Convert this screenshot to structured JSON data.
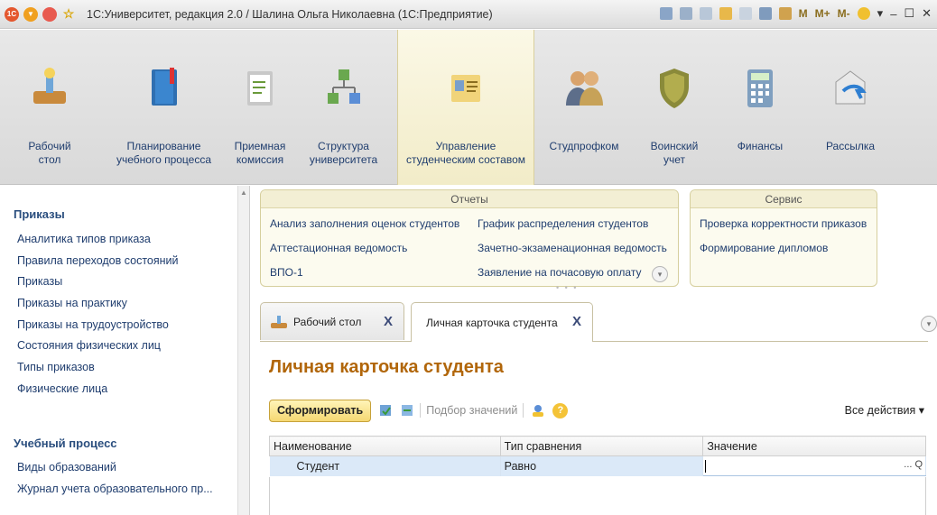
{
  "window": {
    "title": "1С:Университет, редакция 2.0 / Шалина Ольга Николаевна  (1С:Предприятие)",
    "tools": [
      "M",
      "M+",
      "M-"
    ]
  },
  "sections": [
    {
      "label1": "Рабочий",
      "label2": "стол",
      "icon": "desk-icon"
    },
    {
      "label1": "Планирование",
      "label2": "учебного процесса",
      "icon": "book-icon"
    },
    {
      "label1": "Приемная",
      "label2": "комиссия",
      "icon": "clipboard-icon"
    },
    {
      "label1": "Структура",
      "label2": "университета",
      "icon": "structure-icon"
    },
    {
      "label1": "Управление",
      "label2": "студенческим составом",
      "icon": "id-card-icon"
    },
    {
      "label1": "Студпрофком",
      "label2": "",
      "icon": "people-icon"
    },
    {
      "label1": "Воинский",
      "label2": "учет",
      "icon": "shield-icon"
    },
    {
      "label1": "Финансы",
      "label2": "",
      "icon": "calculator-icon"
    },
    {
      "label1": "Рассылка",
      "label2": "",
      "icon": "mail-icon"
    }
  ],
  "nav": {
    "groups": [
      {
        "title": "Приказы",
        "items": [
          "Аналитика типов приказа",
          "Правила переходов состояний",
          "Приказы",
          "Приказы на практику",
          "Приказы на трудоустройство",
          "Состояния физических лиц",
          "Типы приказов",
          "Физические лица"
        ]
      },
      {
        "title": "Учебный процесс",
        "items": [
          "Виды образований",
          "Журнал учета образовательного пр..."
        ]
      }
    ]
  },
  "reports": {
    "title": "Отчеты",
    "col1": [
      "Анализ заполнения оценок студентов",
      "Аттестационная ведомость",
      "ВПО-1"
    ],
    "col2": [
      "График распределения студентов",
      "Зачетно-экзаменационная ведомость",
      "Заявление на почасовую оплату"
    ]
  },
  "service": {
    "title": "Сервис",
    "items": [
      "Проверка корректности приказов",
      "Формирование дипломов"
    ]
  },
  "tabs": [
    {
      "label": "Рабочий стол",
      "close": "X"
    },
    {
      "label": "Личная карточка студента",
      "close": "X"
    }
  ],
  "form": {
    "title": "Личная карточка студента",
    "generate_label": "Сформировать",
    "pick_values_label": "Подбор значений",
    "all_actions_label": "Все действия ▾",
    "help_label": "?",
    "columns": [
      "Наименование",
      "Тип сравнения",
      "Значение"
    ],
    "rows": [
      {
        "name": "Студент",
        "comparison": "Равно",
        "value": ""
      }
    ],
    "value_buttons": [
      "...",
      "Q"
    ]
  },
  "colors": {
    "accent_orange": "#b1660a",
    "link_blue": "#1f3d6e",
    "active_section_bg": "#f2ecc8"
  }
}
